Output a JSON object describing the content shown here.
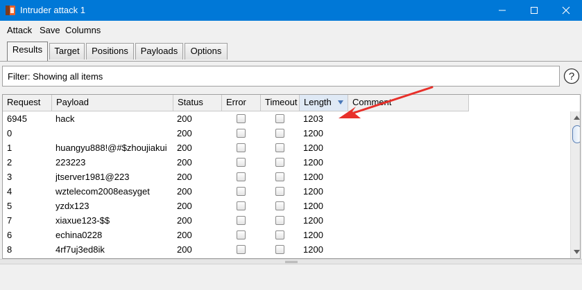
{
  "window": {
    "title": "Intruder attack 1",
    "icons": {
      "app": "burp-icon",
      "minimize": "minimize-icon",
      "maximize": "maximize-icon",
      "close": "close-icon"
    }
  },
  "menu": {
    "attack": "Attack",
    "save": "Save",
    "columns": "Columns"
  },
  "tabs": {
    "results": "Results",
    "target": "Target",
    "positions": "Positions",
    "payloads": "Payloads",
    "options": "Options",
    "active": "results"
  },
  "filter": {
    "text": "Filter: Showing all items"
  },
  "table": {
    "columns": [
      "Request",
      "Payload",
      "Status",
      "Error",
      "Timeout",
      "Length",
      "Comment"
    ],
    "sorted_column": "Length",
    "rows": [
      {
        "request": "6945",
        "payload": "hack",
        "status": "200",
        "error": false,
        "timeout": false,
        "length": "1203"
      },
      {
        "request": "0",
        "payload": "",
        "status": "200",
        "error": false,
        "timeout": false,
        "length": "1200"
      },
      {
        "request": "1",
        "payload": "huangyu888!@#$zhoujiakui",
        "status": "200",
        "error": false,
        "timeout": false,
        "length": "1200"
      },
      {
        "request": "2",
        "payload": "223223",
        "status": "200",
        "error": false,
        "timeout": false,
        "length": "1200"
      },
      {
        "request": "3",
        "payload": "jtserver1981@223",
        "status": "200",
        "error": false,
        "timeout": false,
        "length": "1200"
      },
      {
        "request": "4",
        "payload": "wztelecom2008easyget",
        "status": "200",
        "error": false,
        "timeout": false,
        "length": "1200"
      },
      {
        "request": "5",
        "payload": "yzdx123",
        "status": "200",
        "error": false,
        "timeout": false,
        "length": "1200"
      },
      {
        "request": "7",
        "payload": "xiaxue123-$$",
        "status": "200",
        "error": false,
        "timeout": false,
        "length": "1200"
      },
      {
        "request": "6",
        "payload": "echina0228",
        "status": "200",
        "error": false,
        "timeout": false,
        "length": "1200"
      },
      {
        "request": "8",
        "payload": "4rf7uj3ed8ik",
        "status": "200",
        "error": false,
        "timeout": false,
        "length": "1200"
      }
    ]
  },
  "colors": {
    "titlebar": "#0078d7",
    "annotation_arrow": "#e8302a",
    "sort_arrow": "#4a78b8"
  }
}
